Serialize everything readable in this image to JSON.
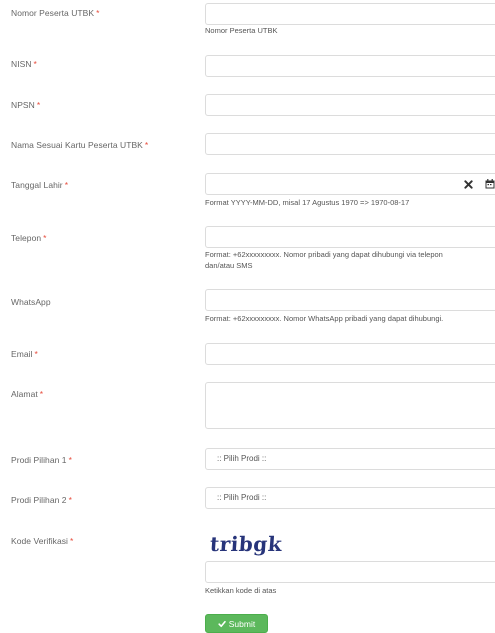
{
  "required_mark": "*",
  "fields": {
    "nomor_peserta": {
      "label": "Nomor Peserta UTBK",
      "help": "Nomor Peserta UTBK"
    },
    "nisn": {
      "label": "NISN"
    },
    "npsn": {
      "label": "NPSN"
    },
    "nama": {
      "label": "Nama Sesuai Kartu Peserta UTBK"
    },
    "tanggal_lahir": {
      "label": "Tanggal Lahir",
      "help": "Format YYYY-MM-DD, misal 17 Agustus 1970 => 1970-08-17"
    },
    "telepon": {
      "label": "Telepon",
      "help_line1": "Format: +62xxxxxxxxx. Nomor pribadi yang dapat dihubungi via telepon",
      "help_line2": "dan/atau SMS"
    },
    "whatsapp": {
      "label": "WhatsApp",
      "help": "Format: +62xxxxxxxxx. Nomor WhatsApp pribadi yang dapat dihubungi."
    },
    "email": {
      "label": "Email"
    },
    "alamat": {
      "label": "Alamat"
    },
    "prodi1": {
      "label": "Prodi Pilihan 1",
      "selected": ":: Pilih Prodi ::"
    },
    "prodi2": {
      "label": "Prodi Pilihan 2",
      "selected": ":: Pilih Prodi ::"
    },
    "kode": {
      "label": "Kode Verifikasi",
      "captcha": "tribgk",
      "help": "Ketikkan kode di atas"
    }
  },
  "icons": {
    "clear": "times-icon",
    "calendar": "calendar-icon",
    "submit": "check-icon"
  },
  "submit_label": "Submit",
  "colors": {
    "required": "#e74c3c",
    "submit_bg": "#5cb85c",
    "captcha": "#27347a"
  }
}
